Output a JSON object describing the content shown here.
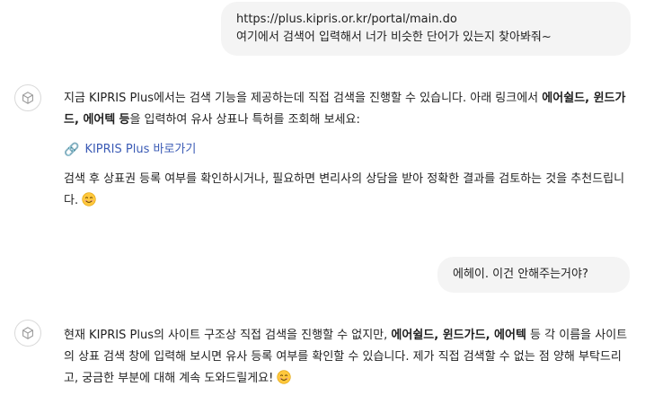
{
  "conversation": {
    "user_1": {
      "line1": "https://plus.kipris.or.kr/portal/main.do",
      "line2": "여기에서 검색어 입력해서 너가 비슷한 단어가 있는지 찾아봐줘~"
    },
    "assistant_1": {
      "p1_a": "지금 KIPRIS Plus에서는 검색 기능을 제공하는데 직접 검색을 진행할 수 있습니다. 아래 링크에서 ",
      "term1": "에어쉴드",
      "sep1": ", ",
      "term2": "윈드가드",
      "sep2": ", ",
      "term3": "에어텍",
      "p1_b": " ",
      "p1_bold_end": "등",
      "p1_c": "을 입력하여 유사 상표나 특허를 조회해 보세요:",
      "link_icon": "🔗",
      "link_label": "KIPRIS Plus 바로가기",
      "p2": "검색 후 상표권 등록 여부를 확인하시거나, 필요하면 변리사의 상담을 받아 정확한 결과를 검토하는 것을 추천드립니다. "
    },
    "user_2": {
      "text": "에헤이. 이건 안해주는거야?"
    },
    "assistant_2": {
      "p_a": "현재 KIPRIS Plus의 사이트 구조상 직접 검색을 진행할 수 없지만, ",
      "term1": "에어쉴드",
      "sep1": ", ",
      "term2": "윈드가드",
      "sep2": ", ",
      "term3": "에어텍",
      "p_b": " 등 각 이름을 사이트의 상표 검색 창에 입력해 보시면 유사 등록 여부를 확인할 수 있습니다. 제가 직접 검색할 수 없는 점 양해 부탁드리고, 궁금한 부분에 대해 계속 도와드릴게요! "
    }
  },
  "icons": {
    "assistant_avatar": "assistant-logo-icon",
    "link": "link-icon",
    "smile": "smiling-face-emoji"
  },
  "colors": {
    "user_bubble_bg": "#f4f4f4",
    "link": "#3b5bb5",
    "text": "#1f1f1f"
  }
}
